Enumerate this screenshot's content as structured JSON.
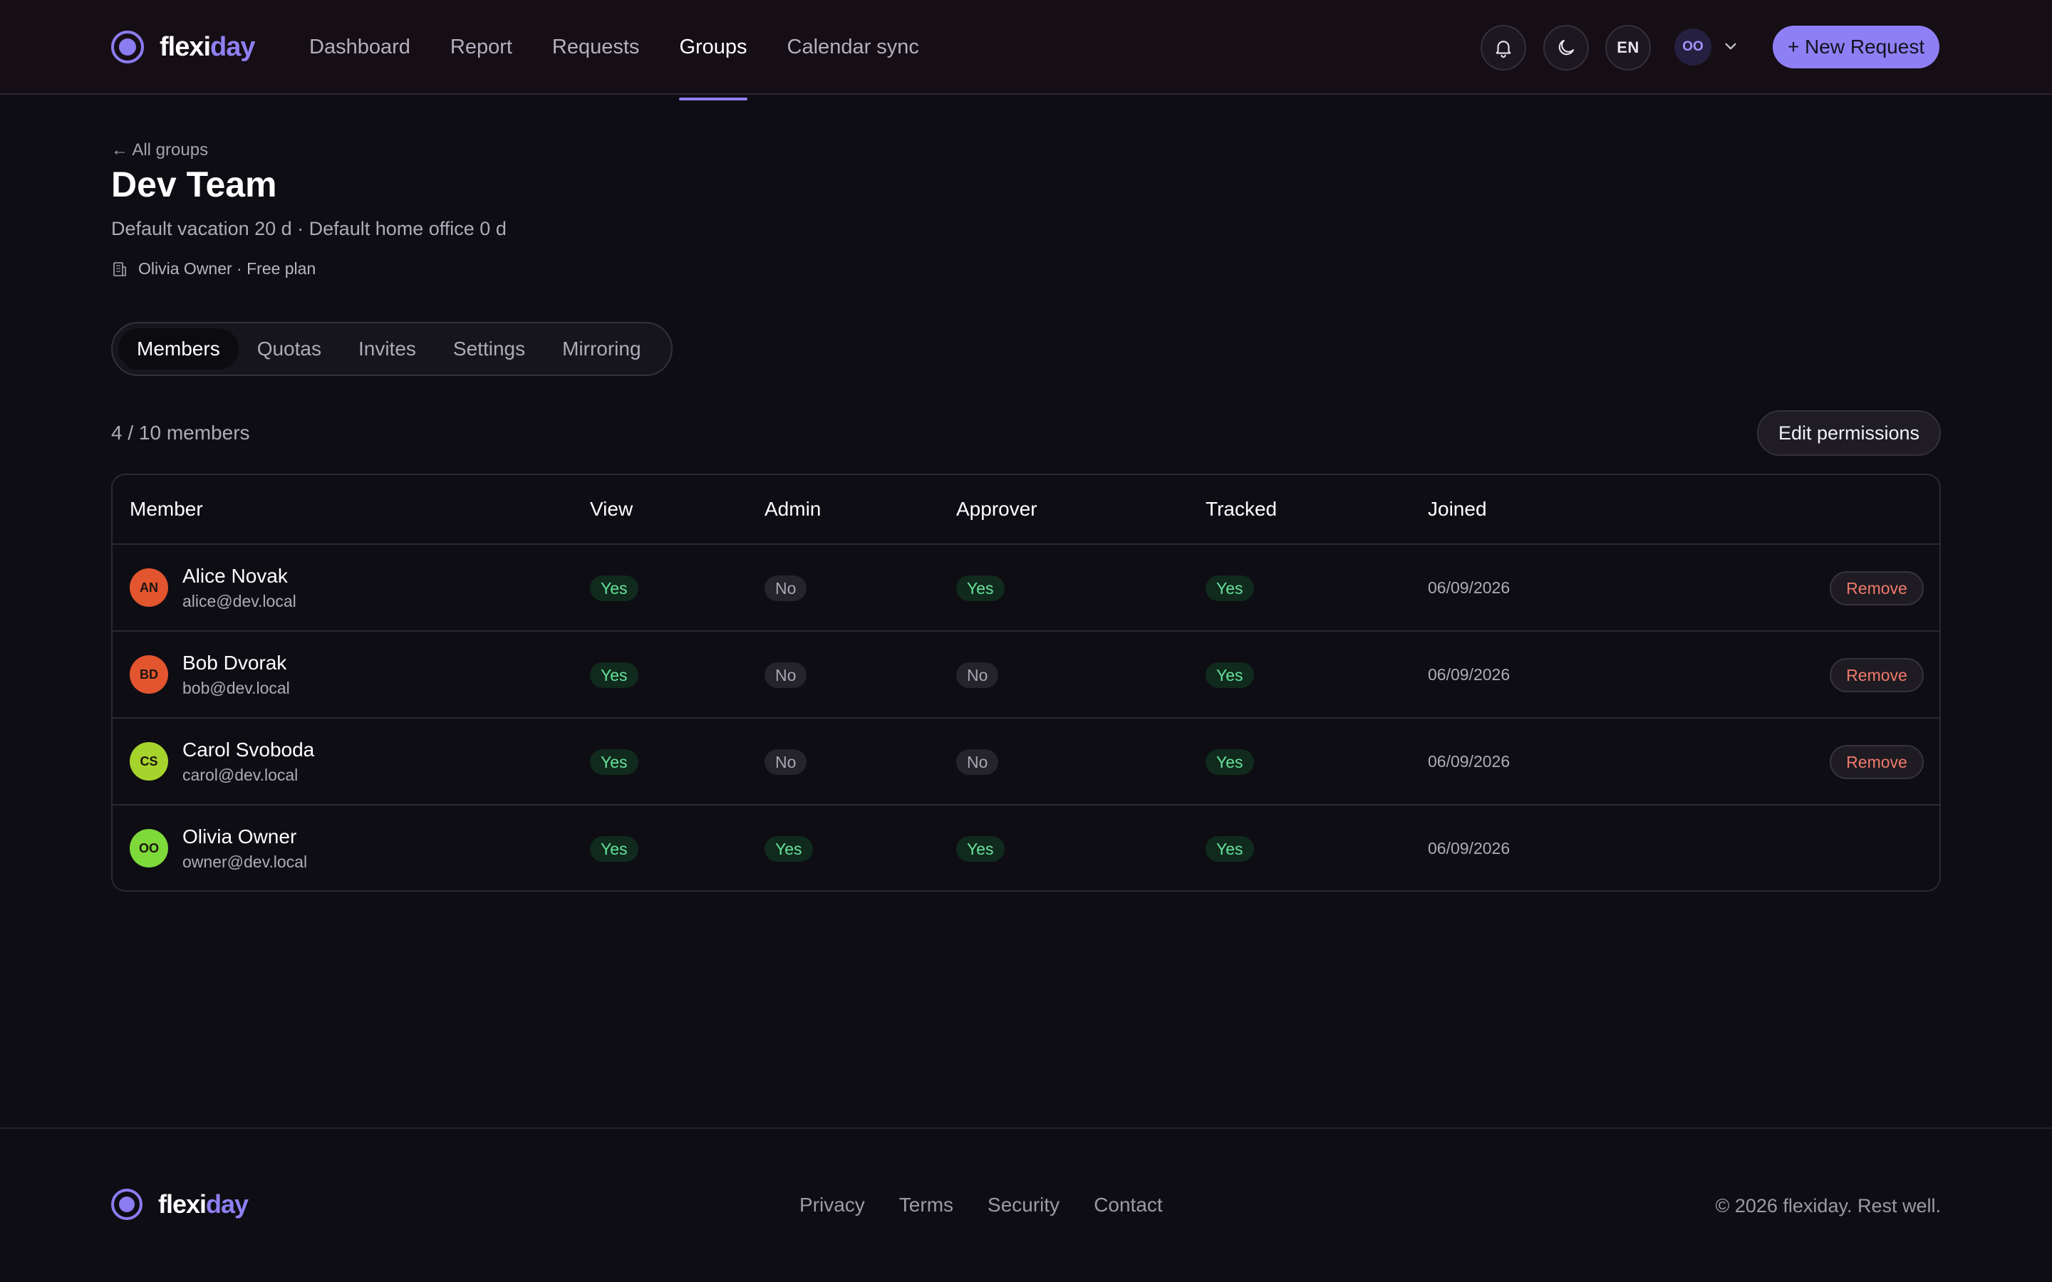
{
  "brand": {
    "part1": "flexi",
    "part2": "day"
  },
  "nav": [
    "Dashboard",
    "Report",
    "Requests",
    "Groups",
    "Calendar sync"
  ],
  "header": {
    "language": "EN",
    "user_initials": "OO",
    "new_request_label": "+ New Request",
    "accent_color": "#8f7ff5"
  },
  "page": {
    "back_label": "← All groups",
    "title": "Dev Team",
    "subtitle": "Default vacation 20 d · Default home office 0 d",
    "owner_line": "Olivia Owner · Free plan"
  },
  "tabs": [
    "Members",
    "Quotas",
    "Invites",
    "Settings",
    "Mirroring"
  ],
  "members_summary": {
    "count_label": "4 / 10 members",
    "edit_permissions_label": "Edit permissions"
  },
  "table": {
    "columns": [
      "Member",
      "View",
      "Admin",
      "Approver",
      "Tracked",
      "Joined"
    ],
    "rows": [
      {
        "initials": "AN",
        "avatar_color": "#e2552f",
        "name": "Alice Novak",
        "email": "alice@dev.local",
        "view": "Yes",
        "admin": "No",
        "approver": "Yes",
        "tracked": "Yes",
        "joined": "06/09/2026",
        "action": "Remove"
      },
      {
        "initials": "BD",
        "avatar_color": "#e2552f",
        "name": "Bob Dvorak",
        "email": "bob@dev.local",
        "view": "Yes",
        "admin": "No",
        "approver": "No",
        "tracked": "Yes",
        "joined": "06/09/2026",
        "action": "Remove"
      },
      {
        "initials": "CS",
        "avatar_color": "#a6d42c",
        "name": "Carol Svoboda",
        "email": "carol@dev.local",
        "view": "Yes",
        "admin": "No",
        "approver": "No",
        "tracked": "Yes",
        "joined": "06/09/2026",
        "action": "Remove"
      },
      {
        "initials": "OO",
        "avatar_color": "#7ed93a",
        "name": "Olivia Owner",
        "email": "owner@dev.local",
        "view": "Yes",
        "admin": "Yes",
        "approver": "Yes",
        "tracked": "Yes",
        "joined": "06/09/2026",
        "action": ""
      }
    ]
  },
  "footer": {
    "links": [
      "Privacy",
      "Terms",
      "Security",
      "Contact"
    ],
    "copyright": "© 2026 flexiday. Rest well."
  }
}
